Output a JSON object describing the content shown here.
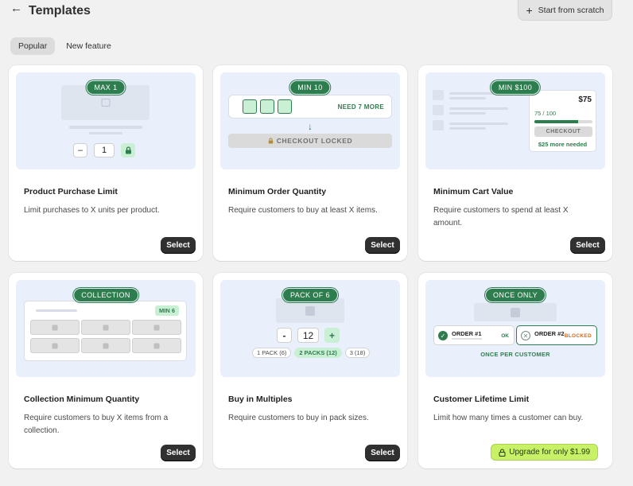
{
  "header": {
    "back_icon": "arrow-left-icon",
    "title": "Templates",
    "scratch_label": "Start from scratch",
    "scratch_icon": "plus-icon"
  },
  "tabs": [
    {
      "label": "Popular",
      "active": true
    },
    {
      "label": "New feature",
      "active": false
    }
  ],
  "cards": [
    {
      "badge": "MAX 1",
      "title": "Product Purchase Limit",
      "desc": "Limit purchases to X units per product.",
      "action": "Select",
      "preview": {
        "minus": "–",
        "value": "1",
        "lock_icon": "lock-icon"
      }
    },
    {
      "badge": "MIN 10",
      "title": "Minimum Order Quantity",
      "desc": "Require customers to buy at least X items.",
      "action": "Select",
      "preview": {
        "need": "NEED 7 MORE",
        "arrow": "↓",
        "locked": "CHECKOUT LOCKED",
        "lock_icon": "lock-icon"
      }
    },
    {
      "badge": "MIN $100",
      "title": "Minimum Cart Value",
      "desc": "Require customers to spend at least X amount.",
      "action": "Select",
      "preview": {
        "amount": "$75",
        "progress_text": "75 / 100",
        "progress": 0.75,
        "checkout": "CHECKOUT",
        "more": "$25 more needed"
      }
    },
    {
      "badge": "COLLECTION",
      "title": "Collection Minimum Quantity",
      "desc": "Require customers to buy X items from a collection.",
      "action": "Select",
      "preview": {
        "min": "MIN 6"
      }
    },
    {
      "badge": "PACK OF 6",
      "title": "Buy in Multiples",
      "desc": "Require customers to buy in pack sizes.",
      "action": "Select",
      "preview": {
        "minus": "-",
        "value": "12",
        "plus": "+",
        "chips": [
          "1 PACK (6)",
          "2 PACKS (12)",
          "3 (18)"
        ]
      }
    },
    {
      "badge": "ONCE ONLY",
      "title": "Customer Lifetime Limit",
      "desc": "Limit how many times a customer can buy.",
      "action": "Upgrade for only $1.99",
      "preview": {
        "order1": "ORDER #1",
        "order1_status": "OK",
        "order2": "ORDER #2",
        "order2_status": "BLOCKED",
        "footer": "ONCE PER CUSTOMER"
      }
    }
  ]
}
